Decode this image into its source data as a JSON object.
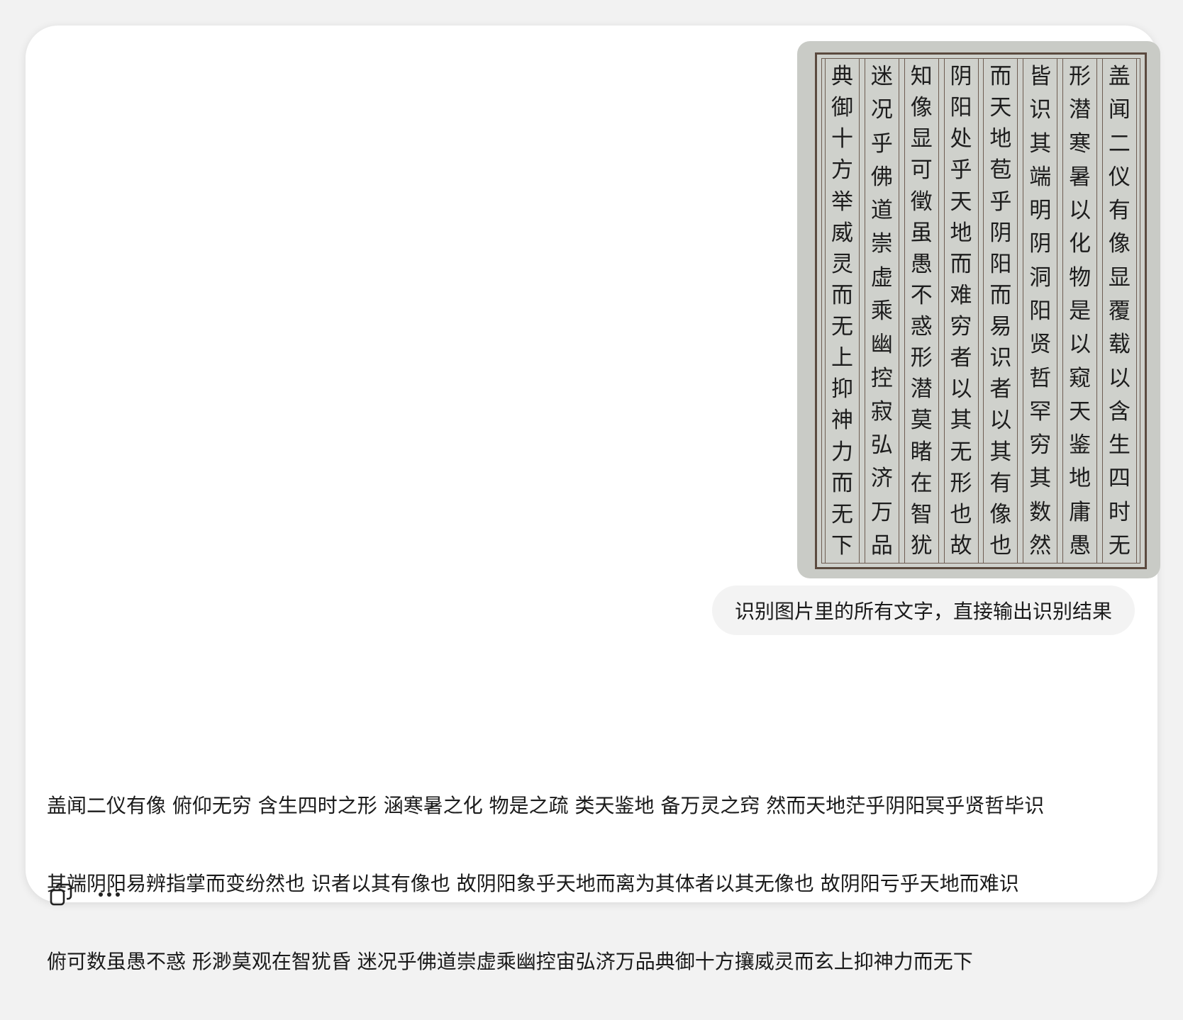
{
  "conversation": {
    "image_columns": [
      "盖闻二仪有像显覆载以含生四时无",
      "形潜寒暑以化物是以窥天鉴地庸愚",
      "皆识其端明阴洞阳贤哲罕穷其数然",
      "而天地苞乎阴阳而易识者以其有像也",
      "阴阳处乎天地而难穷者以其无形也故",
      "知像显可徵虽愚不惑形潜莫睹在智犹",
      "迷况乎佛道崇虚乘幽控寂弘济万品",
      "典御十方举威灵而无上抑神力而无下"
    ],
    "user_prompt": "识别图片里的所有文字，直接输出识别结果",
    "answer_lines": [
      "盖闻二仪有像 俯仰无穷 含生四时之形 涵寒暑之化 物是之疏 类天鉴地 备万灵之窍 然而天地茫乎阴阳冥乎贤哲毕识",
      "其端阴阳易辨指掌而变纷然也 识者以其有像也 故阴阳象乎天地而离为其体者以其无像也 故阴阳亏乎天地而难识",
      "俯可数虽愚不惑 形渺莫观在智犹昏 迷况乎佛道崇虚乘幽控宙弘济万品典御十方攘威灵而玄上抑神力而无下"
    ],
    "actions": {
      "copy_icon": "copy-icon",
      "more_icon": "more-dots-icon"
    }
  }
}
